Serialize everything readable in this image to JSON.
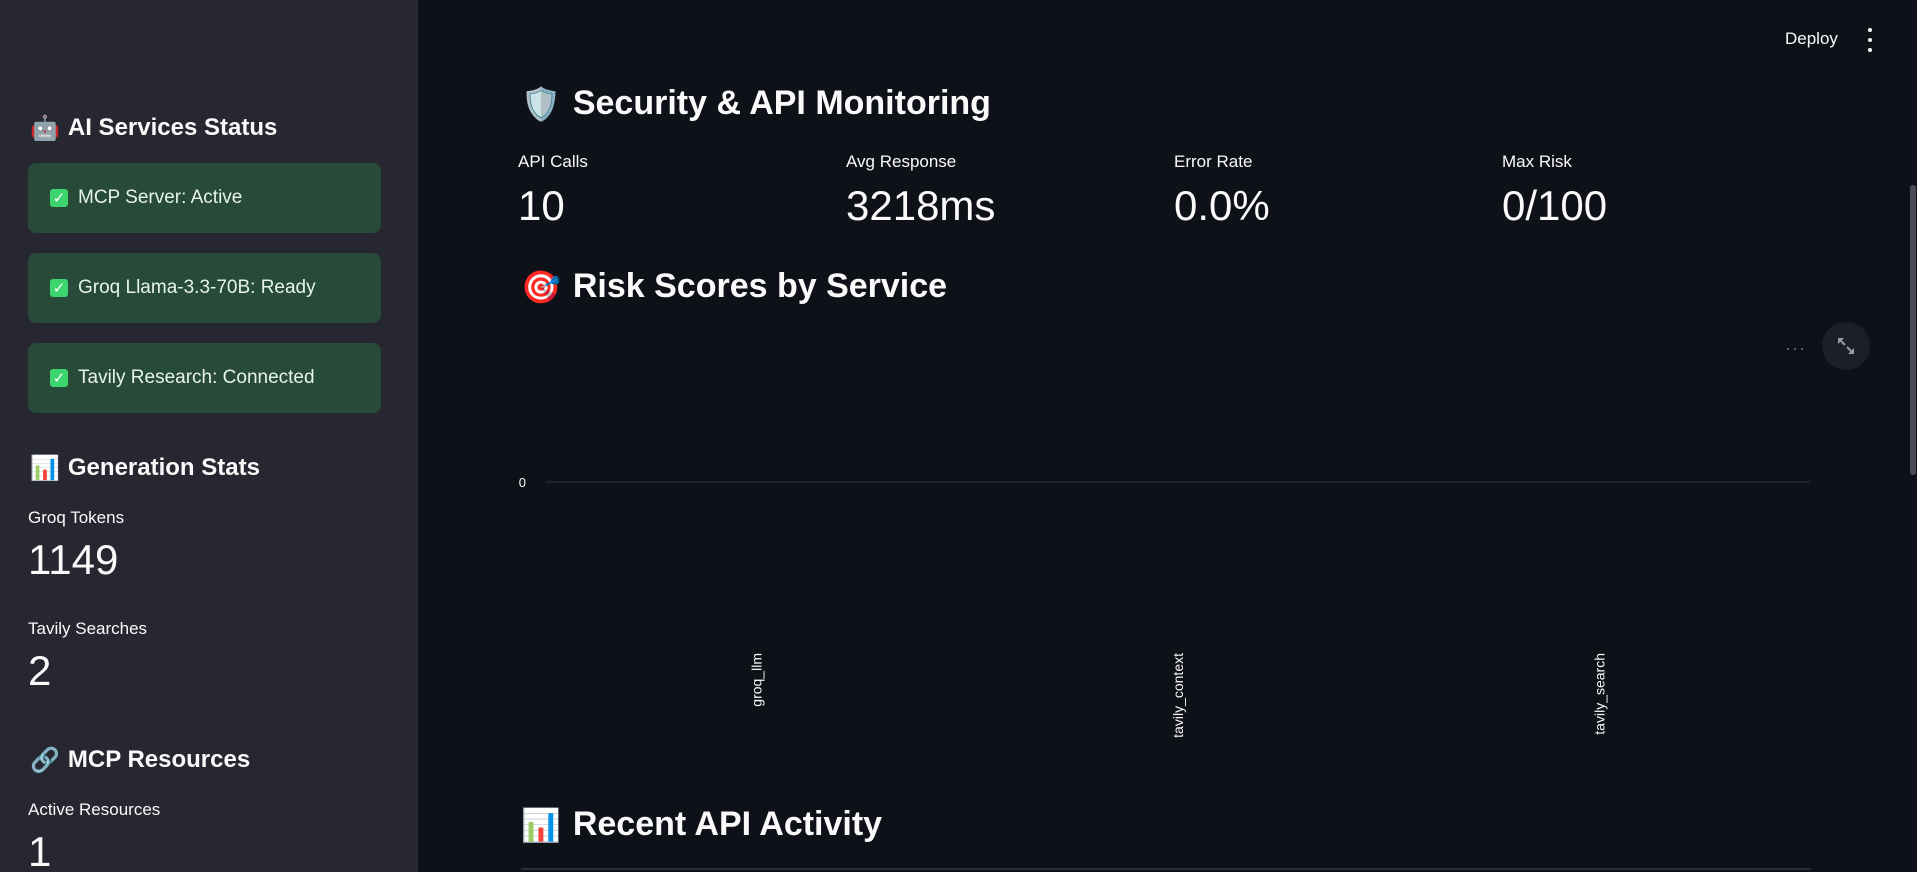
{
  "sidebar": {
    "services_heading": "AI Services Status",
    "services_icon": "robot-icon",
    "services": [
      {
        "label": "MCP Server: Active"
      },
      {
        "label": "Groq Llama-3.3-70B: Ready"
      },
      {
        "label": "Tavily Research: Connected"
      }
    ],
    "generation_heading": "Generation Stats",
    "generation_icon": "bar-chart-icon",
    "groq_tokens_label": "Groq Tokens",
    "groq_tokens_value": "1149",
    "tavily_searches_label": "Tavily Searches",
    "tavily_searches_value": "2",
    "resources_heading": "MCP Resources",
    "resources_icon": "link-icon",
    "active_resources_label": "Active Resources",
    "active_resources_value": "1"
  },
  "header": {
    "deploy_label": "Deploy",
    "menu_icon": "kebab-menu-icon"
  },
  "main": {
    "security_heading": "Security & API Monitoring",
    "security_icon": "shield-icon",
    "kpis": [
      {
        "label": "API Calls",
        "value": "10"
      },
      {
        "label": "Avg Response",
        "value": "3218ms"
      },
      {
        "label": "Error Rate",
        "value": "0.0%"
      },
      {
        "label": "Max Risk",
        "value": "0/100"
      }
    ],
    "risk_heading": "Risk Scores by Service",
    "risk_icon": "target-icon",
    "activity_heading": "Recent API Activity",
    "activity_icon": "bar-chart-icon"
  },
  "chart_data": {
    "type": "bar",
    "categories": [
      "groq_llm",
      "tavily_context",
      "tavily_search"
    ],
    "values": [
      0,
      0,
      0
    ],
    "y_ticks": [
      "0"
    ],
    "grid": false,
    "colors": {
      "axis": "#31333f",
      "tick_text": "#fafafa"
    }
  }
}
